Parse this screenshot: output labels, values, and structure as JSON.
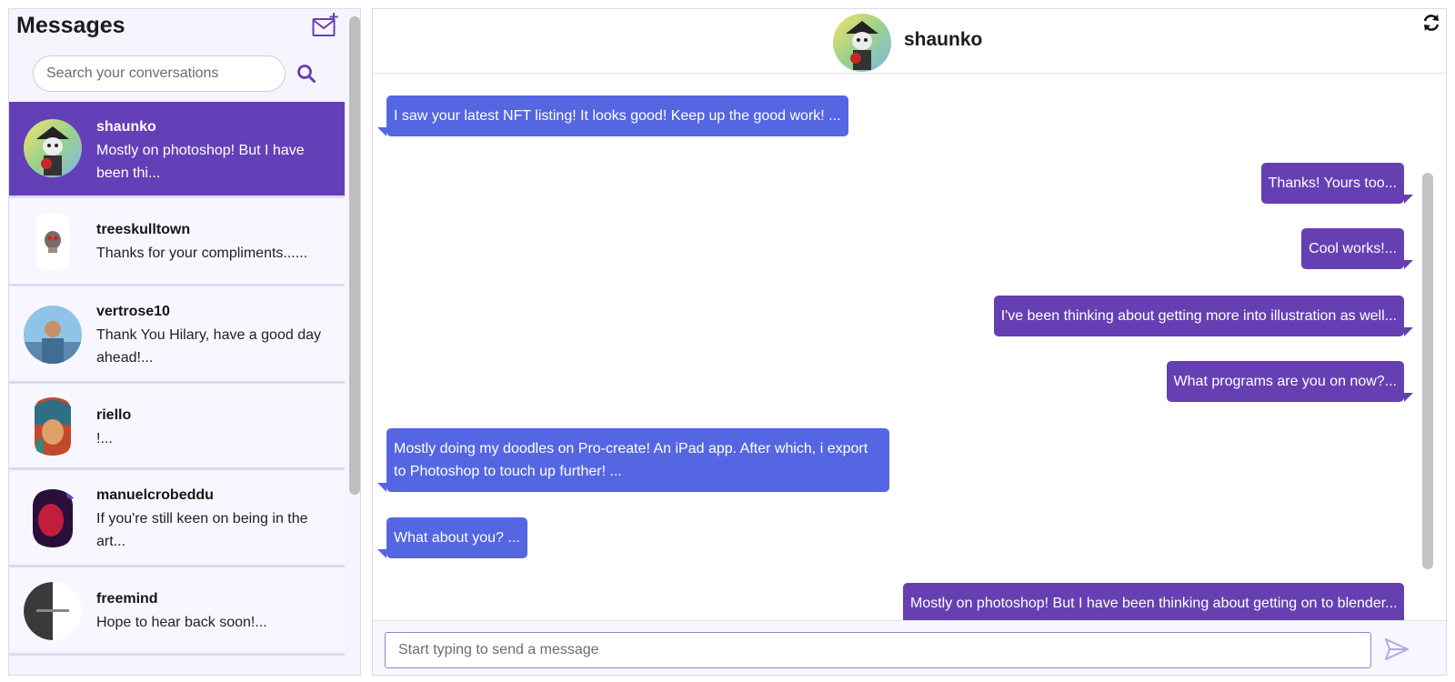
{
  "sidebar": {
    "title": "Messages",
    "search_placeholder": "Search your conversations",
    "conversations": [
      {
        "name": "shaunko",
        "preview": "Mostly on photoshop! But I have been thi...",
        "active": true,
        "avatar": "pirate-cat-avatar"
      },
      {
        "name": "treeskulltown",
        "preview": "Thanks for your compliments......",
        "active": false,
        "avatar": "skull-avatar"
      },
      {
        "name": "vertrose10",
        "preview": "Thank You Hilary, have a good day ahead!...",
        "active": false,
        "avatar": "photo-avatar"
      },
      {
        "name": "riello",
        "preview": "!...",
        "active": false,
        "avatar": "portrait-avatar"
      },
      {
        "name": "manuelcrobeddu",
        "preview": "If you're still keen on being in the art...",
        "active": false,
        "avatar": "red-face-avatar"
      },
      {
        "name": "freemind",
        "preview": "Hope to hear back soon!...",
        "active": false,
        "avatar": "freemind-logo-avatar"
      }
    ]
  },
  "chat": {
    "contact_name": "shaunko",
    "messages": [
      {
        "direction": "in",
        "text": "I saw your latest NFT listing! It looks good! Keep up the good work! ..."
      },
      {
        "direction": "out",
        "text": "Thanks! Yours too..."
      },
      {
        "direction": "out",
        "text": "Cool works!..."
      },
      {
        "direction": "out",
        "text": "I've been thinking about getting more into illustration as well..."
      },
      {
        "direction": "out",
        "text": "What programs are you on now?..."
      },
      {
        "direction": "in",
        "text": "Mostly doing my doodles on Pro-create! An iPad app. After which, i export to Photoshop to touch up further! ..."
      },
      {
        "direction": "in",
        "text": "What about you? ..."
      },
      {
        "direction": "out",
        "text": "Mostly on photoshop! But I have been thinking about getting on to blender..."
      }
    ],
    "composer_placeholder": "Start typing to send a message"
  },
  "colors": {
    "accent": "#6640b3",
    "incoming_bubble": "#5566e2",
    "outgoing_bubble": "#6640b3"
  }
}
